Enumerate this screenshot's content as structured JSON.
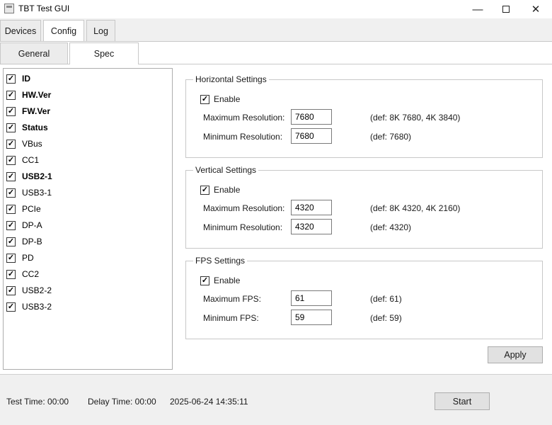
{
  "window": {
    "title": "TBT Test GUI",
    "minimize_glyph": "—",
    "close_glyph": "✕"
  },
  "outer_tabs": [
    {
      "label": "Devices"
    },
    {
      "label": "Config",
      "selected": true
    },
    {
      "label": "Log"
    }
  ],
  "inner_tabs": [
    {
      "label": "General"
    },
    {
      "label": "Spec",
      "selected": true
    }
  ],
  "signals": [
    {
      "label": "ID",
      "checked": true,
      "bold": true
    },
    {
      "label": "HW.Ver",
      "checked": true,
      "bold": true
    },
    {
      "label": "FW.Ver",
      "checked": true,
      "bold": true
    },
    {
      "label": "Status",
      "checked": true,
      "bold": true
    },
    {
      "label": "VBus",
      "checked": true,
      "bold": false
    },
    {
      "label": "CC1",
      "checked": true,
      "bold": false
    },
    {
      "label": "USB2-1",
      "checked": true,
      "bold": true
    },
    {
      "label": "USB3-1",
      "checked": true,
      "bold": false
    },
    {
      "label": "PCIe",
      "checked": true,
      "bold": false
    },
    {
      "label": "DP-A",
      "checked": true,
      "bold": false
    },
    {
      "label": "DP-B",
      "checked": true,
      "bold": false
    },
    {
      "label": "PD",
      "checked": true,
      "bold": false
    },
    {
      "label": "CC2",
      "checked": true,
      "bold": false
    },
    {
      "label": "USB2-2",
      "checked": true,
      "bold": false
    },
    {
      "label": "USB3-2",
      "checked": true,
      "bold": false
    }
  ],
  "horizontal": {
    "title": "Horizontal Settings",
    "enable_label": "Enable",
    "enabled": true,
    "max_label": "Maximum Resolution:",
    "max_value": "7680",
    "max_def": "(def: 8K 7680, 4K 3840)",
    "min_label": "Minimum Resolution:",
    "min_value": "7680",
    "min_def": "(def: 7680)"
  },
  "vertical": {
    "title": "Vertical Settings",
    "enable_label": "Enable",
    "enabled": true,
    "max_label": "Maximum Resolution:",
    "max_value": "4320",
    "max_def": "(def: 8K 4320, 4K 2160)",
    "min_label": "Minimum Resolution:",
    "min_value": "4320",
    "min_def": "(def: 4320)"
  },
  "fps": {
    "title": "FPS Settings",
    "enable_label": "Enable",
    "enabled": true,
    "max_label": "Maximum FPS:",
    "max_value": "61",
    "max_def": "(def: 61)",
    "min_label": "Minimum FPS:",
    "min_value": "59",
    "min_def": "(def: 59)"
  },
  "apply_label": "Apply",
  "status": {
    "test_time": "Test Time: 00:00",
    "delay_time": "Delay Time: 00:00",
    "datetime": "2025-06-24 14:35:11",
    "start_label": "Start"
  },
  "checkmark_glyph": "✓"
}
